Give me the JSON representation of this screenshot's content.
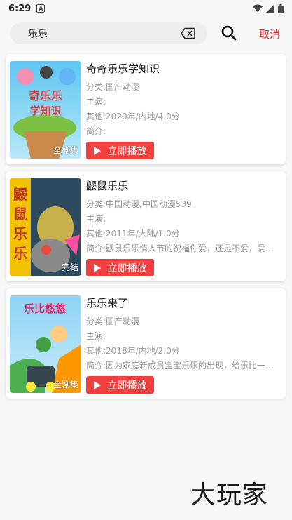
{
  "status_bar": {
    "time": "6:29",
    "notif_letter": "A"
  },
  "search": {
    "value": "乐乐",
    "cancel_label": "取消"
  },
  "results": [
    {
      "title": "奇奇乐乐学知识",
      "category": "分类:国产动漫",
      "cast": "主演:",
      "other": "其他:2020年/内地/4.0分",
      "intro": "简介:",
      "badge": "全剧集",
      "play_label": "立即播放"
    },
    {
      "title": "鼹鼠乐乐",
      "category": "分类:中国动漫,中国动漫539",
      "cast": "主演:",
      "other": "其他:2011年/大陆/1.0分",
      "intro": "简介:鼹鼠乐乐情人节的祝福你爱，还是不爱，爱都在那里",
      "badge": "完结",
      "play_label": "立即播放"
    },
    {
      "title": "乐乐来了",
      "category": "分类:国产动漫",
      "cast": "主演:",
      "other": "其他:2018年/内地/2.0分",
      "intro": "简介:因为家庭新成员宝宝乐乐的出现，给乐比一家带来了欢乐",
      "badge": "全剧集",
      "play_label": "立即播放"
    }
  ],
  "watermark": "大玩家",
  "colors": {
    "accent": "#e8262b",
    "play_button": "#ef3f3f"
  }
}
